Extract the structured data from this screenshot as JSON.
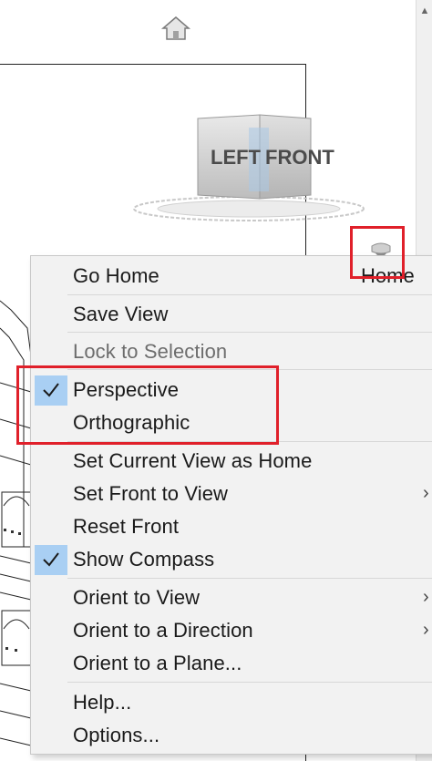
{
  "toolbar": {
    "home_icon": "home-icon"
  },
  "viewcube": {
    "left_face": "LEFT",
    "front_face": "FRONT",
    "menu_icon": "viewcube-menu-icon"
  },
  "context_menu": {
    "go_home": {
      "label": "Go Home",
      "shortcut": "Home"
    },
    "save_view": {
      "label": "Save View"
    },
    "lock_to_selection": {
      "label": "Lock to Selection",
      "disabled": true
    },
    "perspective": {
      "label": "Perspective",
      "checked": true
    },
    "orthographic": {
      "label": "Orthographic",
      "checked": false
    },
    "set_current_view_as_home": {
      "label": "Set Current View as Home"
    },
    "set_front_to_view": {
      "label": "Set Front to View",
      "submenu": true
    },
    "reset_front": {
      "label": "Reset Front"
    },
    "show_compass": {
      "label": "Show Compass",
      "checked": true
    },
    "orient_to_view": {
      "label": "Orient to View",
      "submenu": true
    },
    "orient_to_a_direction": {
      "label": "Orient to a Direction",
      "submenu": true
    },
    "orient_to_a_plane": {
      "label": "Orient to a Plane..."
    },
    "help": {
      "label": "Help..."
    },
    "options": {
      "label": "Options..."
    }
  },
  "colors": {
    "highlight_red": "#e0202a",
    "check_bg": "#a9cff3",
    "menu_bg": "#f2f2f2"
  }
}
